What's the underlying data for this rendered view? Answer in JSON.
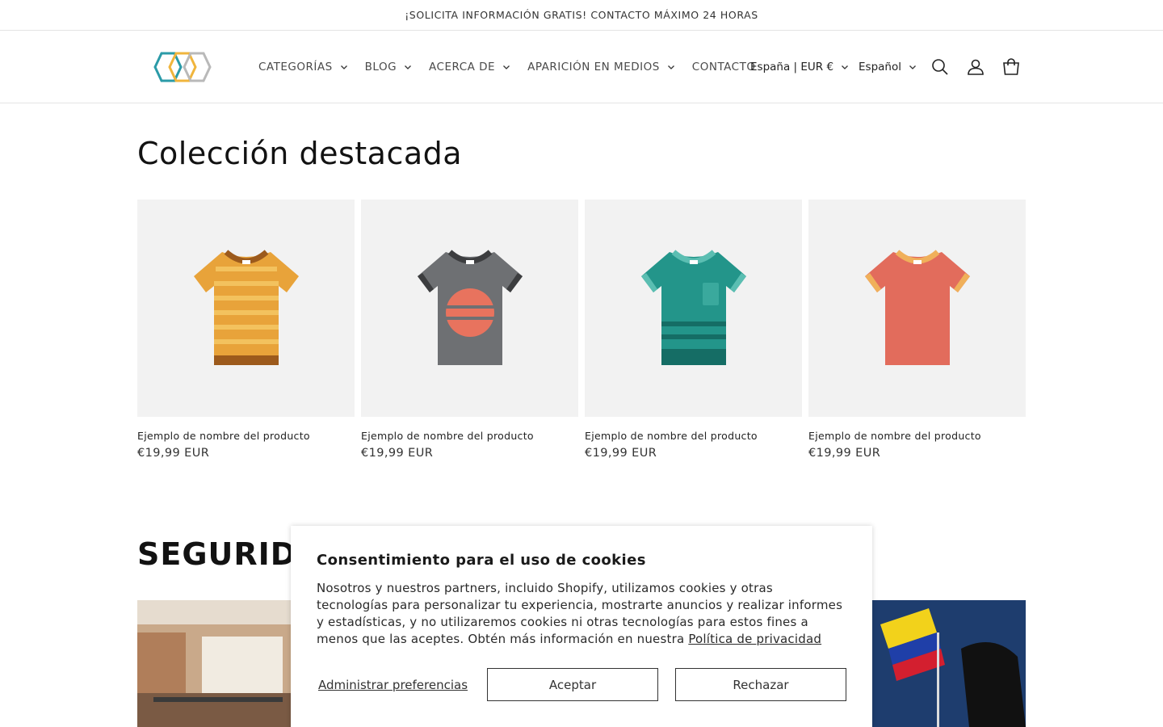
{
  "announcement": {
    "text": "¡SOLICITA INFORMACIÓN GRATIS! CONTACTO MÁXIMO 24 HORAS"
  },
  "header": {
    "nav": [
      {
        "label": "CATEGORÍAS",
        "dropdown": true
      },
      {
        "label": "BLOG",
        "dropdown": true
      },
      {
        "label": "ACERCA DE",
        "dropdown": true
      },
      {
        "label": "APARICIÓN EN MEDIOS",
        "dropdown": true
      },
      {
        "label": "CONTACTO",
        "dropdown": false
      }
    ],
    "country_selector": "España | EUR €",
    "language_selector": "Español",
    "icons": [
      "search-icon",
      "account-icon",
      "cart-icon"
    ]
  },
  "featured": {
    "title": "Colección destacada",
    "products": [
      {
        "name": "Ejemplo de nombre del producto",
        "price": "€19,99 EUR",
        "color": "#e8a33a"
      },
      {
        "name": "Ejemplo de nombre del producto",
        "price": "€19,99 EUR",
        "color": "#6e7073"
      },
      {
        "name": "Ejemplo de nombre del producto",
        "price": "€19,99 EUR",
        "color": "#23958a"
      },
      {
        "name": "Ejemplo de nombre del producto",
        "price": "€19,99 EUR",
        "color": "#e26c5c"
      }
    ]
  },
  "security": {
    "title": "SEGURIDAD"
  },
  "cookie_banner": {
    "title": "Consentimiento para el uso de cookies",
    "body": "Nosotros y nuestros partners, incluido Shopify, utilizamos cookies y otras tecnologías para personalizar tu experiencia, mostrarte anuncios y realizar informes y estadísticas, y no utilizaremos cookies ni otras tecnologías para estos fines a menos que las aceptes. Obtén más información en nuestra",
    "privacy_link": "Política de privacidad",
    "manage_label": "Administrar preferencias",
    "accept_label": "Aceptar",
    "reject_label": "Rechazar"
  }
}
